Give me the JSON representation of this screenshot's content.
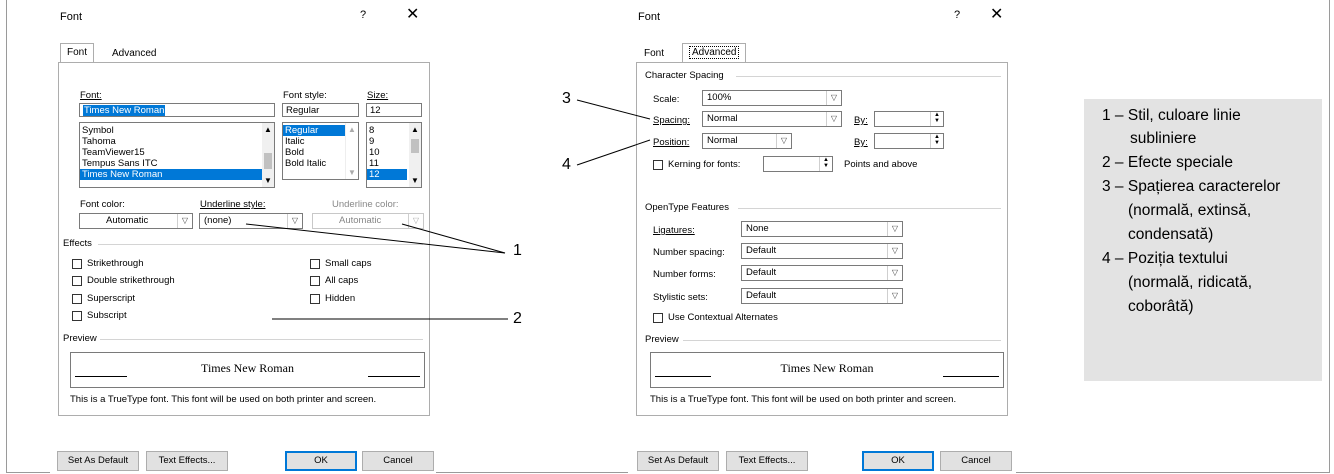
{
  "dialog1": {
    "title": "Font",
    "help": "?",
    "close": "✕",
    "tabs": [
      {
        "label": "Font",
        "active": true
      },
      {
        "label": "Advanced",
        "active": false
      }
    ],
    "font_label": "Font:",
    "font_value": "Times New Roman",
    "font_list": [
      "Symbol",
      "Tahoma",
      "TeamViewer15",
      "Tempus Sans ITC",
      "Times New Roman"
    ],
    "style_label": "Font style:",
    "style_value": "Regular",
    "style_list": [
      "Regular",
      "Italic",
      "Bold",
      "Bold Italic"
    ],
    "size_label": "Size:",
    "size_value": "12",
    "size_list": [
      "8",
      "9",
      "10",
      "11",
      "12"
    ],
    "font_color_label": "Font color:",
    "font_color_value": "Automatic",
    "underline_style_label": "Underline style:",
    "underline_style_value": "(none)",
    "underline_color_label": "Underline color:",
    "underline_color_value": "Automatic",
    "effects_label": "Effects",
    "effects": {
      "strikethrough": "Strikethrough",
      "double_strikethrough": "Double strikethrough",
      "superscript": "Superscript",
      "subscript": "Subscript",
      "small_caps": "Small caps",
      "all_caps": "All caps",
      "hidden": "Hidden"
    },
    "preview_label": "Preview",
    "preview_text": "Times New Roman",
    "note": "This is a TrueType font. This font will be used on both printer and screen.",
    "buttons": {
      "set_default": "Set As Default",
      "text_effects": "Text Effects...",
      "ok": "OK",
      "cancel": "Cancel"
    }
  },
  "dialog2": {
    "title": "Font",
    "help": "?",
    "close": "✕",
    "tabs": [
      {
        "label": "Font",
        "active": false
      },
      {
        "label": "Advanced",
        "active": true
      }
    ],
    "char_spacing_label": "Character Spacing",
    "scale_label": "Scale:",
    "scale_value": "100%",
    "spacing_label": "Spacing:",
    "spacing_value": "Normal",
    "by_label": "By:",
    "position_label": "Position:",
    "position_value": "Normal",
    "by2_label": "By:",
    "kerning_label": "Kerning for fonts:",
    "points_label": "Points and above",
    "opentype_label": "OpenType Features",
    "ligatures_label": "Ligatures:",
    "ligatures_value": "None",
    "number_spacing_label": "Number spacing:",
    "number_spacing_value": "Default",
    "number_forms_label": "Number forms:",
    "number_forms_value": "Default",
    "stylistic_sets_label": "Stylistic sets:",
    "stylistic_sets_value": "Default",
    "contextual_label": "Use Contextual Alternates",
    "preview_label": "Preview",
    "preview_text": "Times New Roman",
    "note": "This is a TrueType font. This font will be used on both printer and screen.",
    "buttons": {
      "set_default": "Set As Default",
      "text_effects": "Text Effects...",
      "ok": "OK",
      "cancel": "Cancel"
    }
  },
  "callouts": {
    "n1": "1",
    "n2": "2",
    "n3": "3",
    "n4": "4"
  },
  "legend": [
    "1 – Stil, culoare linie",
    "subliniere",
    "2 – Efecte speciale",
    "3 – Spațierea caracterelor",
    "(normală, extinsă,",
    "condensată)",
    "4 – Poziția textului",
    "(normală, ridicată,",
    "coborâtă)"
  ]
}
